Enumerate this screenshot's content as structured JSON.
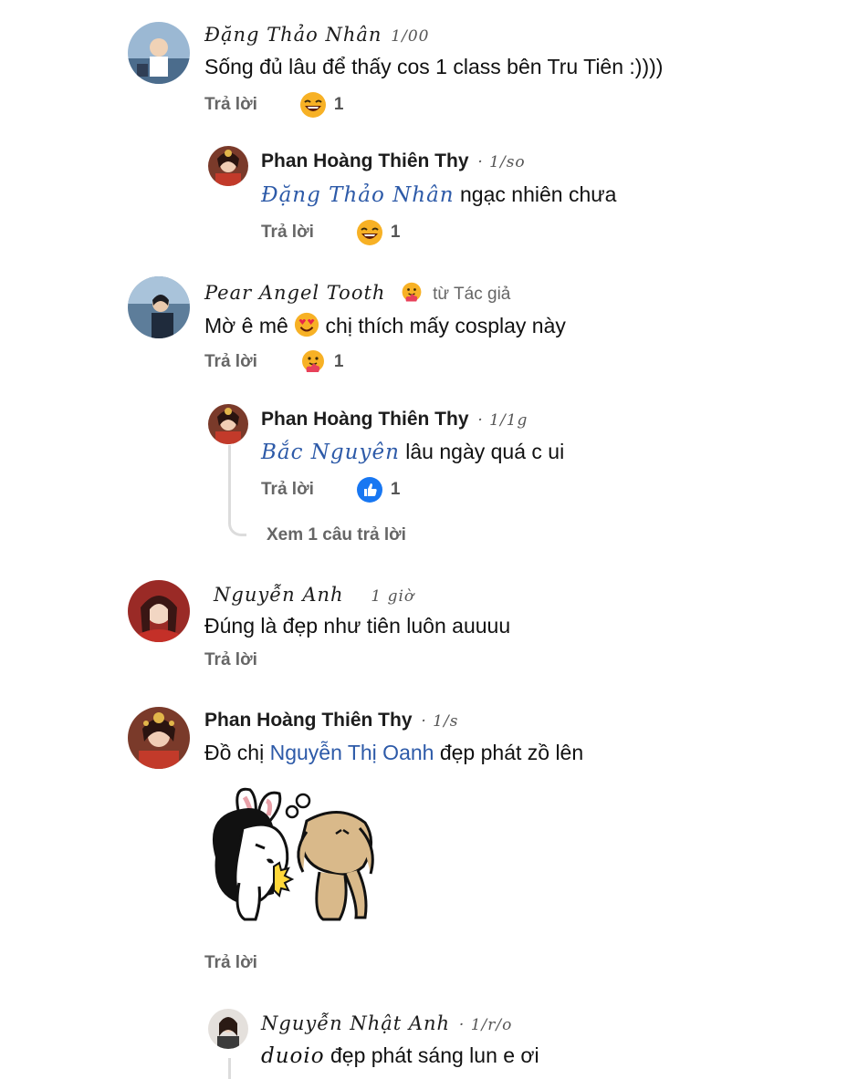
{
  "comments": [
    {
      "author": "Đặng Thảo Nhân",
      "time": "1/00",
      "text": "Sống đủ lâu để thấy cos 1 class bên Tru Tiên :))))",
      "reply_label": "Trả lời",
      "reaction_icon": "laugh-emoji",
      "reaction_count": "1"
    },
    {
      "author": "Phan Hoàng Thiên Thy",
      "time": "· 1/so",
      "mention": "Đặng Thảo Nhân",
      "text": " ngạc nhiên chưa",
      "reply_label": "Trả lời",
      "reaction_icon": "laugh-emoji",
      "reaction_count": "1"
    },
    {
      "author": "Pear Angel Tooth",
      "badge": "từ Tác giả",
      "text_before": "Mờ ê mê ",
      "text_after": " chị thích mấy cosplay này",
      "reply_label": "Trả lời",
      "reaction_icon": "care-emoji",
      "reaction_count": "1"
    },
    {
      "author": "Phan Hoàng Thiên Thy",
      "time": "· 1/1g",
      "mention": "Bắc Nguyên",
      "text": " lâu ngày quá c ui",
      "reply_label": "Trả lời",
      "reaction_icon": "like-icon",
      "reaction_count": "1",
      "see_more": "Xem 1 câu trả lời"
    },
    {
      "author": "Nguyễn Anh",
      "time": "1 giờ",
      "text": "Đúng là đẹp như tiên luôn auuuu",
      "reply_label": "Trả lời"
    },
    {
      "author": "Phan Hoàng Thiên Thy",
      "time": "· 1/s",
      "text_before": "Đồ chị ",
      "mention": "Nguyễn Thị Oanh",
      "text_after": " đẹp phát zồ lên",
      "sticker": "bunny-kiss-sticker",
      "reply_label": "Trả lời"
    },
    {
      "author": "Nguyễn Nhật Anh",
      "time": "· 1/r/o",
      "mention": "duoio",
      "text": " đẹp phát sáng lun e ơi"
    }
  ]
}
